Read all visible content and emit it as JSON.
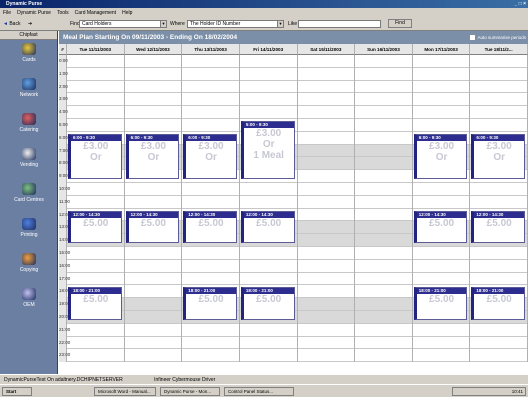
{
  "window": {
    "title": "Dynamic Purse",
    "sys_buttons": "_ □ ×"
  },
  "menu": [
    "File",
    "Dynamic Purse",
    "Tools",
    "Card Management",
    "Help"
  ],
  "toolbar": {
    "back": "Back",
    "find_label": "Find",
    "find_value": "Card Holders",
    "where_label": "Where",
    "where_value": "The Holder ID Number",
    "like_label": "Like",
    "like_value": "",
    "find_button": "Find"
  },
  "sidebar": {
    "header": "Chipfast",
    "items": [
      {
        "label": "Cards",
        "icon": "cards-icon"
      },
      {
        "label": "Network",
        "icon": "network-icon"
      },
      {
        "label": "Catering",
        "icon": "catering-icon"
      },
      {
        "label": "Vending",
        "icon": "vending-icon"
      },
      {
        "label": "Card Centres",
        "icon": "card-centres-icon"
      },
      {
        "label": "Printing",
        "icon": "printing-icon"
      },
      {
        "label": "Copying",
        "icon": "copying-icon"
      },
      {
        "label": "OEM",
        "icon": "oem-icon"
      }
    ]
  },
  "schedule": {
    "title": "Meal Plan Starting On 09/11/2003 - Ending On 18/02/2004",
    "auto_label": "Auto summarise periods",
    "corner": "#",
    "days": [
      "Tue 11/11/2003",
      "Wed 12/11/2003",
      "Thu 13/11/2003",
      "Fri 14/11/2003",
      "Sat 15/11/2003",
      "Sun 16/11/2003",
      "Mon 17/11/2003",
      "Tue 18/11/2..."
    ],
    "hours": [
      "0:00",
      "1:00",
      "2:00",
      "3:00",
      "4:00",
      "5:00",
      "6:00",
      "7:00",
      "8:00",
      "9:00",
      "10:00",
      "11:00",
      "12:00",
      "13:00",
      "14:00",
      "15:00",
      "16:00",
      "17:00",
      "18:00",
      "19:00",
      "20:00",
      "21:00",
      "22:00",
      "23:00"
    ],
    "blocks": [
      {
        "day": 0,
        "start": 6,
        "end": 9,
        "time": "6:00 - 9:30",
        "price": "£3.00",
        "note": "Or"
      },
      {
        "day": 1,
        "start": 6,
        "end": 9,
        "time": "6:00 - 9:30",
        "price": "£3.00",
        "note": "Or"
      },
      {
        "day": 2,
        "start": 6,
        "end": 9,
        "time": "6:00 - 9:30",
        "price": "£3.00",
        "note": "Or"
      },
      {
        "day": 3,
        "start": 5,
        "end": 9,
        "time": "5:00 - 9:30",
        "price": "£3.00",
        "note": "Or 1 Meal"
      },
      {
        "day": 6,
        "start": 6,
        "end": 9,
        "time": "6:00 - 9:30",
        "price": "£3.00",
        "note": "Or"
      },
      {
        "day": 7,
        "start": 6,
        "end": 9,
        "time": "6:00 - 9:30",
        "price": "£3.00",
        "note": "Or"
      },
      {
        "day": 0,
        "start": 12,
        "end": 14,
        "time": "12:00 - 14:30",
        "price": "£5.00",
        "note": ""
      },
      {
        "day": 1,
        "start": 12,
        "end": 14,
        "time": "12:00 - 14:30",
        "price": "£5.00",
        "note": ""
      },
      {
        "day": 2,
        "start": 12,
        "end": 14,
        "time": "12:00 - 14:30",
        "price": "£5.00",
        "note": ""
      },
      {
        "day": 3,
        "start": 12,
        "end": 14,
        "time": "12:00 - 14:30",
        "price": "£5.00",
        "note": ""
      },
      {
        "day": 6,
        "start": 12,
        "end": 14,
        "time": "12:00 - 14:30",
        "price": "£5.00",
        "note": ""
      },
      {
        "day": 7,
        "start": 12,
        "end": 14,
        "time": "12:00 - 14:30",
        "price": "£5.00",
        "note": ""
      },
      {
        "day": 0,
        "start": 18,
        "end": 20,
        "time": "18:00 - 21:00",
        "price": "£5.00",
        "note": ""
      },
      {
        "day": 2,
        "start": 18,
        "end": 20,
        "time": "18:00 - 21:00",
        "price": "£5.00",
        "note": ""
      },
      {
        "day": 3,
        "start": 18,
        "end": 20,
        "time": "18:00 - 21:00",
        "price": "£5.00",
        "note": ""
      },
      {
        "day": 6,
        "start": 18,
        "end": 20,
        "time": "18:00 - 21:00",
        "price": "£5.00",
        "note": ""
      },
      {
        "day": 7,
        "start": 18,
        "end": 20,
        "time": "18:00 - 21:00",
        "price": "£5.00",
        "note": ""
      }
    ]
  },
  "status": {
    "left": "DynamicPurseTest On adaltnery.DCHIPNETSERVER",
    "right": "Infineer Cybermouse Driver"
  },
  "taskbar": {
    "start": "Start",
    "items": [
      "Microsoft Word - Manual...",
      "Dynamic Purse - Mon...",
      "Control Panel Status..."
    ],
    "clock": "10:41"
  },
  "colors": {
    "accent": "#2d2d8f",
    "header": "#7b8fa8",
    "sidebar": "#6b7fa3"
  }
}
